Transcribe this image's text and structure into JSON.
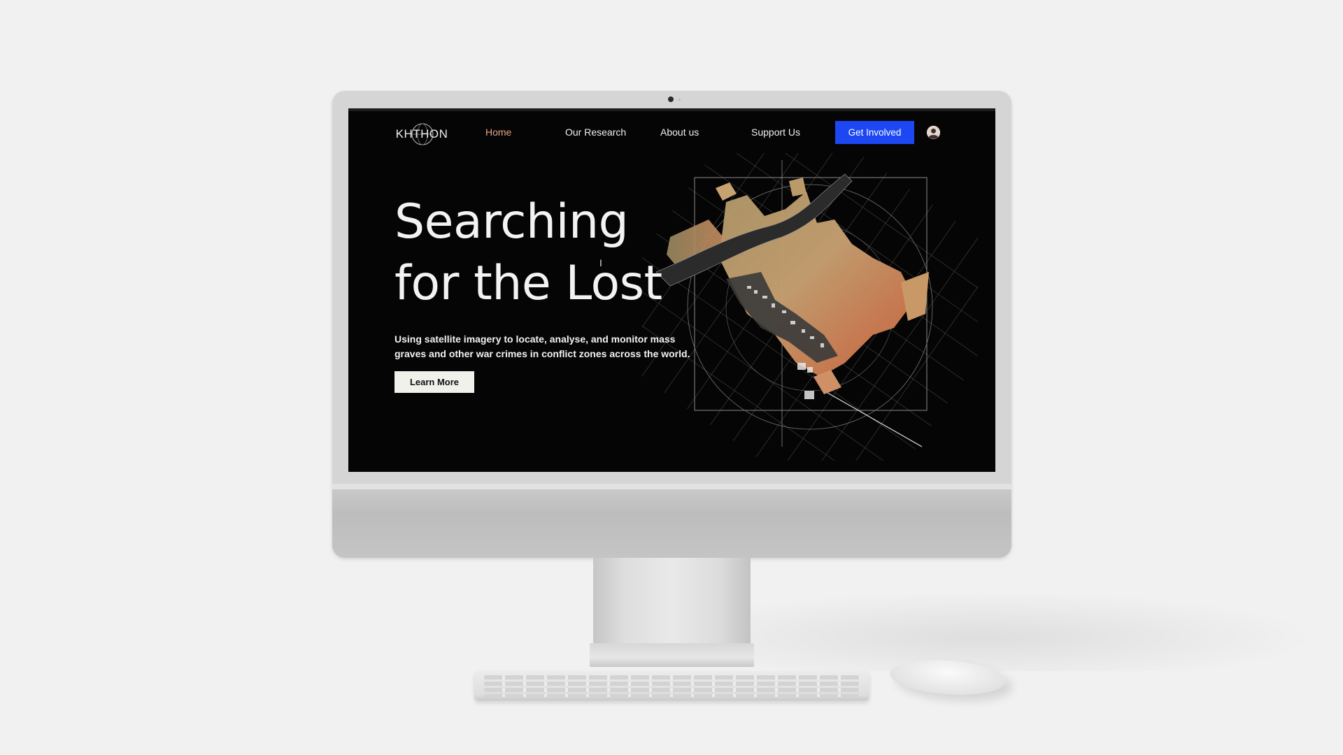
{
  "brand": {
    "logo_text": "KHTHON"
  },
  "nav": {
    "items": [
      {
        "label": "Home",
        "active": true
      },
      {
        "label": "Our Research",
        "active": false
      },
      {
        "label": "About us",
        "active": false
      },
      {
        "label": "Support Us",
        "active": false
      }
    ],
    "cta_label": "Get Involved",
    "account_icon": "user-circle-icon"
  },
  "hero": {
    "title_line1": "Searching",
    "title_line2": "for the Lost",
    "description": "Using satellite imagery to locate, analyse, and monitor mass graves and other war crimes in conflict zones across the world.",
    "button_label": "Learn More",
    "cursor_glyph": "I"
  },
  "colors": {
    "background": "#050505",
    "active_nav": "#e8a487",
    "cta": "#1d47f2",
    "button_light": "#f1f1ec",
    "text": "#f3f3f3"
  }
}
